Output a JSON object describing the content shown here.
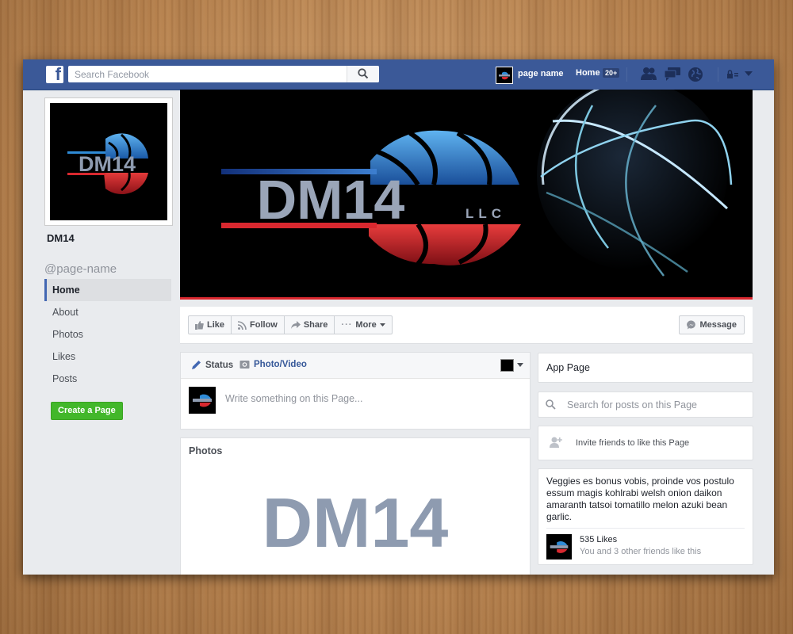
{
  "header": {
    "logo_letter": "f",
    "search_placeholder": "Search Facebook",
    "page_name": "page name",
    "home_label": "Home",
    "home_badge": "20+"
  },
  "profile": {
    "logo_text": "DM14",
    "page_title": "DM14",
    "handle": "@page-name"
  },
  "sidebar": {
    "items": [
      {
        "label": "Home",
        "active": true
      },
      {
        "label": "About"
      },
      {
        "label": "Photos"
      },
      {
        "label": "Likes"
      },
      {
        "label": "Posts"
      }
    ],
    "create_page_label": "Create a Page"
  },
  "cover": {
    "logo_text": "DM14",
    "suffix": "LLC"
  },
  "actions": {
    "like": "Like",
    "follow": "Follow",
    "share": "Share",
    "more": "More",
    "message": "Message"
  },
  "composer": {
    "status_tab": "Status",
    "photo_tab": "Photo/Video",
    "placeholder": "Write something on this Page..."
  },
  "photos": {
    "title": "Photos",
    "logo_text": "DM14"
  },
  "right": {
    "app_page": "App Page",
    "search_placeholder": "Search for posts on this Page",
    "invite": "Invite friends to like this Page",
    "about": "Veggies es bonus vobis, proinde vos postulo essum magis kohlrabi welsh onion daikon amaranth tatsoi tomatillo melon azuki bean garlic.",
    "likes_count": "535 Likes",
    "likes_sub": "You and 3 other friends like this"
  },
  "colors": {
    "facebook_blue": "#3b5998",
    "logo_red": "#d9282f",
    "logo_blue": "#2f8bd6",
    "logo_grey": "#8e9bb0",
    "create_green": "#42b72a"
  }
}
